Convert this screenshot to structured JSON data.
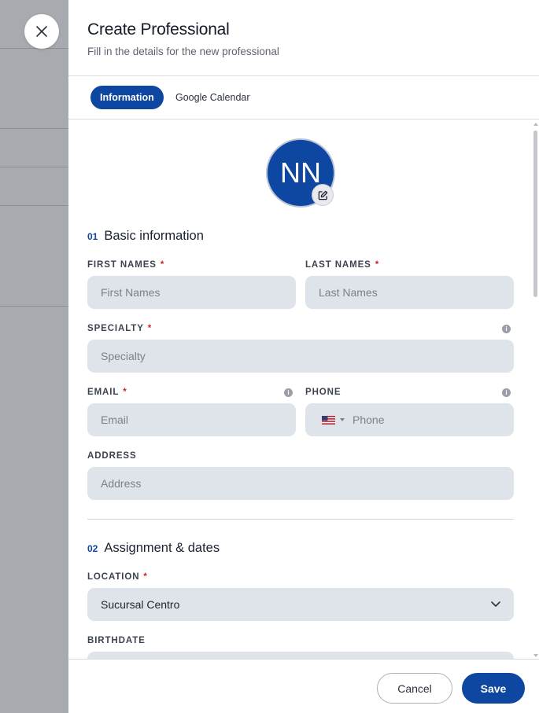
{
  "header": {
    "title": "Create Professional",
    "subtitle": "Fill in the details for the new professional"
  },
  "tabs": [
    {
      "label": "Information",
      "active": true
    },
    {
      "label": "Google Calendar",
      "active": false
    }
  ],
  "avatar": {
    "initials": "NN",
    "edit_icon": "edit-icon"
  },
  "sections": [
    {
      "number": "01",
      "title": "Basic information"
    },
    {
      "number": "02",
      "title": "Assignment & dates"
    }
  ],
  "fields": {
    "first_names": {
      "label": "FIRST NAMES",
      "required": true,
      "placeholder": "First Names"
    },
    "last_names": {
      "label": "LAST NAMES",
      "required": true,
      "placeholder": "Last Names"
    },
    "specialty": {
      "label": "SPECIALTY",
      "required": true,
      "placeholder": "Specialty",
      "info": true
    },
    "email": {
      "label": "EMAIL",
      "required": true,
      "placeholder": "Email",
      "info": true
    },
    "phone": {
      "label": "PHONE",
      "required": false,
      "placeholder": "Phone",
      "info": true,
      "country_flag": "us-flag-icon"
    },
    "address": {
      "label": "ADDRESS",
      "required": false,
      "placeholder": "Address"
    },
    "location": {
      "label": "LOCATION",
      "required": true,
      "value": "Sucursal Centro"
    },
    "birthdate": {
      "label": "BIRTHDATE",
      "required": false
    }
  },
  "required_mark": "*",
  "footer": {
    "cancel_label": "Cancel",
    "save_label": "Save"
  },
  "colors": {
    "primary": "#0d47a1",
    "required": "#c62828",
    "field_bg": "#dfe3ea"
  }
}
